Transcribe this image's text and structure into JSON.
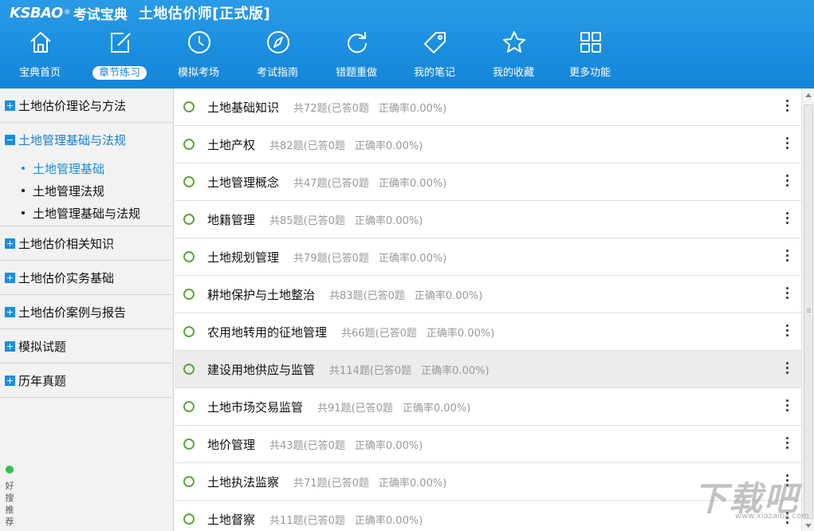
{
  "app": {
    "logo_latin": "KSBAO",
    "logo_reg": "®",
    "logo_cn": "考试宝典",
    "title": "土地估价师[正式版]"
  },
  "nav": [
    {
      "label": "宝典首页",
      "icon": "home-icon"
    },
    {
      "label": "章节练习",
      "icon": "edit-icon",
      "active": true
    },
    {
      "label": "模拟考场",
      "icon": "clock-icon"
    },
    {
      "label": "考试指南",
      "icon": "compass-icon"
    },
    {
      "label": "错题重做",
      "icon": "refresh-icon"
    },
    {
      "label": "我的笔记",
      "icon": "tag-icon"
    },
    {
      "label": "我的收藏",
      "icon": "star-icon"
    },
    {
      "label": "更多功能",
      "icon": "grid-icon"
    }
  ],
  "sidebar": {
    "categories": [
      {
        "label": "土地估价理论与方法",
        "expanded": false
      },
      {
        "label": "土地管理基础与法规",
        "expanded": true,
        "subs": [
          {
            "label": "土地管理基础",
            "active": true
          },
          {
            "label": "土地管理法规"
          },
          {
            "label": "土地管理基础与法规"
          }
        ]
      },
      {
        "label": "土地估价相关知识",
        "expanded": false
      },
      {
        "label": "土地估价实务基础",
        "expanded": false
      },
      {
        "label": "土地估价案例与报告",
        "expanded": false
      },
      {
        "label": "模拟试题",
        "expanded": false
      },
      {
        "label": "历年真题",
        "expanded": false
      }
    ],
    "haosou": "好搜推荐"
  },
  "chapters": [
    {
      "name": "土地基础知识",
      "total": "共72题",
      "answered": "(已答0题",
      "accuracy": "正确率0.00%)"
    },
    {
      "name": "土地产权",
      "total": "共82题",
      "answered": "(已答0题",
      "accuracy": "正确率0.00%)"
    },
    {
      "name": "土地管理概念",
      "total": "共47题",
      "answered": "(已答0题",
      "accuracy": "正确率0.00%)"
    },
    {
      "name": "地籍管理",
      "total": "共85题",
      "answered": "(已答0题",
      "accuracy": "正确率0.00%)"
    },
    {
      "name": "土地规划管理",
      "total": "共79题",
      "answered": "(已答0题",
      "accuracy": "正确率0.00%)"
    },
    {
      "name": "耕地保护与土地整治",
      "total": "共83题",
      "answered": "(已答0题",
      "accuracy": "正确率0.00%)"
    },
    {
      "name": "农用地转用的征地管理",
      "total": "共66题",
      "answered": "(已答0题",
      "accuracy": "正确率0.00%)"
    },
    {
      "name": "建设用地供应与监管",
      "total": "共114题",
      "answered": "(已答0题",
      "accuracy": "正确率0.00%)",
      "hover": true
    },
    {
      "name": "土地市场交易监管",
      "total": "共91题",
      "answered": "(已答0题",
      "accuracy": "正确率0.00%)"
    },
    {
      "name": "地价管理",
      "total": "共43题",
      "answered": "(已答0题",
      "accuracy": "正确率0.00%)"
    },
    {
      "name": "土地执法监察",
      "total": "共71题",
      "answered": "(已答0题",
      "accuracy": "正确率0.00%)"
    },
    {
      "name": "土地督察",
      "total": "共11题",
      "answered": "(已答0题",
      "accuracy": "正确率0.00%)"
    }
  ],
  "watermark": {
    "main": "下载吧",
    "sub": "www.xiazaiba.com"
  },
  "colors": {
    "header": "#1a8ee0",
    "accent": "#1a8ee0",
    "circle": "#5aa83a",
    "haosou_dot": "#2ec24a"
  }
}
